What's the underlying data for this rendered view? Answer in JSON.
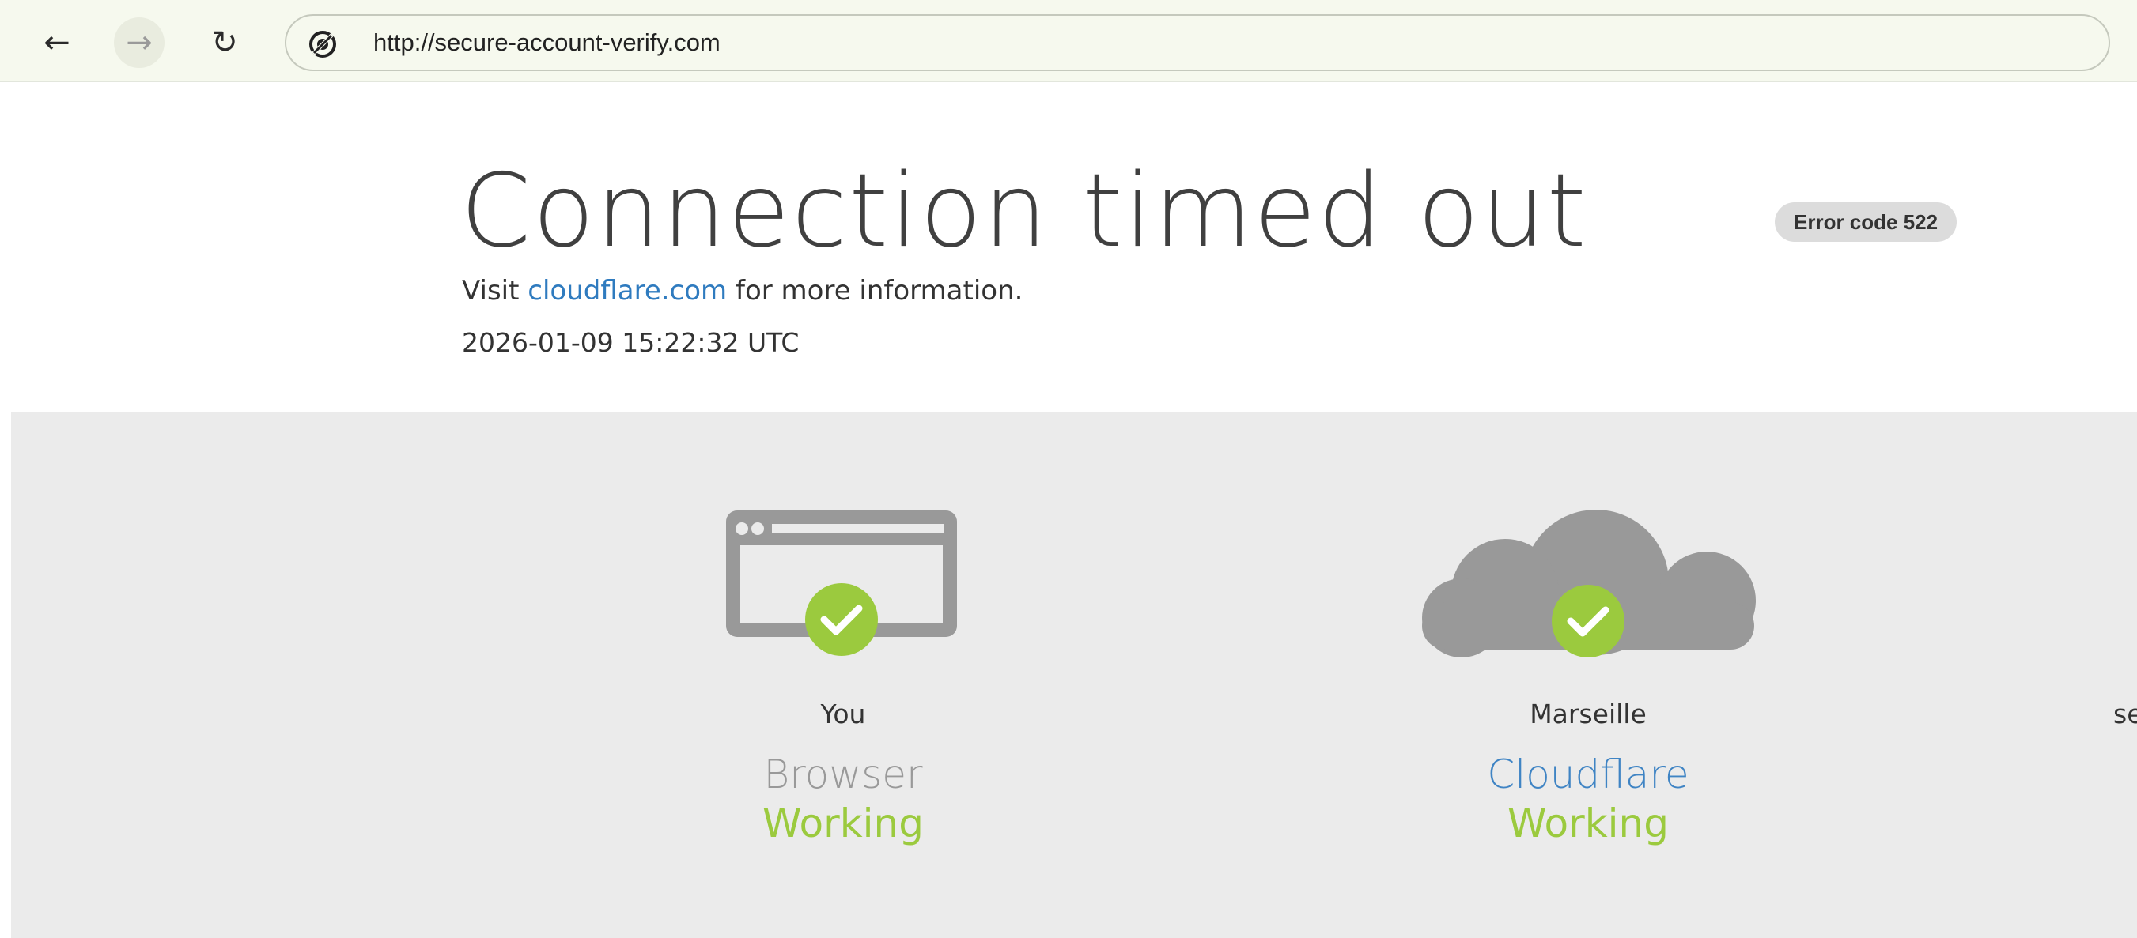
{
  "browser": {
    "url": "http://secure-account-verify.com",
    "back_glyph": "←",
    "forward_glyph": "→",
    "reload_glyph": "↻",
    "site_icon": "not-secure-icon"
  },
  "header": {
    "title": "Connection timed out",
    "error_code": "Error code 522",
    "info_prefix": "Visit ",
    "info_link": "cloudflare.com",
    "info_suffix": " for more information.",
    "timestamp": "2026-01-09 15:22:32 UTC"
  },
  "status": {
    "nodes": [
      {
        "location": "You",
        "name": "Browser",
        "state": "Working",
        "icon": "browser-icon"
      },
      {
        "location": "Marseille",
        "name": "Cloudflare",
        "state": "Working",
        "icon": "cloud-icon"
      },
      {
        "location": "se"
      }
    ]
  },
  "colors": {
    "working_green": "#9bca3e",
    "icon_gray": "#999999",
    "link_blue": "#2f7bbf",
    "panel_bg": "#ebebeb"
  }
}
